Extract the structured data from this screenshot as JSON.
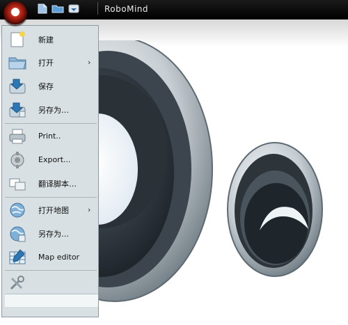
{
  "window": {
    "title": "RoboMind"
  },
  "quick_access": {
    "icons": [
      "new-document-icon",
      "open-folder-icon",
      "save-icon"
    ]
  },
  "app_menu": {
    "items": [
      {
        "label": "新建",
        "icon": "new-document-icon",
        "has_submenu": false
      },
      {
        "label": "打开",
        "icon": "open-folder-icon",
        "has_submenu": true
      },
      {
        "label": "保存",
        "icon": "save-icon",
        "has_submenu": false
      },
      {
        "label": "另存为…",
        "icon": "save-as-icon",
        "has_submenu": false
      },
      {
        "label": "Print..",
        "icon": "printer-icon",
        "has_submenu": false
      },
      {
        "label": "Export...",
        "icon": "export-icon",
        "has_submenu": false
      },
      {
        "label": "翻译脚本…",
        "icon": "translate-script-icon",
        "has_submenu": false
      },
      {
        "label": "打开地图",
        "icon": "open-map-icon",
        "has_submenu": true
      },
      {
        "label": "另存为…",
        "icon": "save-map-as-icon",
        "has_submenu": false
      },
      {
        "label": "Map editor",
        "icon": "map-editor-icon",
        "has_submenu": false
      },
      {
        "label": "",
        "icon": "settings-tools-icon",
        "has_submenu": false
      }
    ],
    "submenu_arrow": "›"
  },
  "colors": {
    "titlebar": "#000000",
    "menu_background": "#d9e0e3",
    "orb_red": "#c9301f",
    "eye_dark": "#2b3238"
  }
}
